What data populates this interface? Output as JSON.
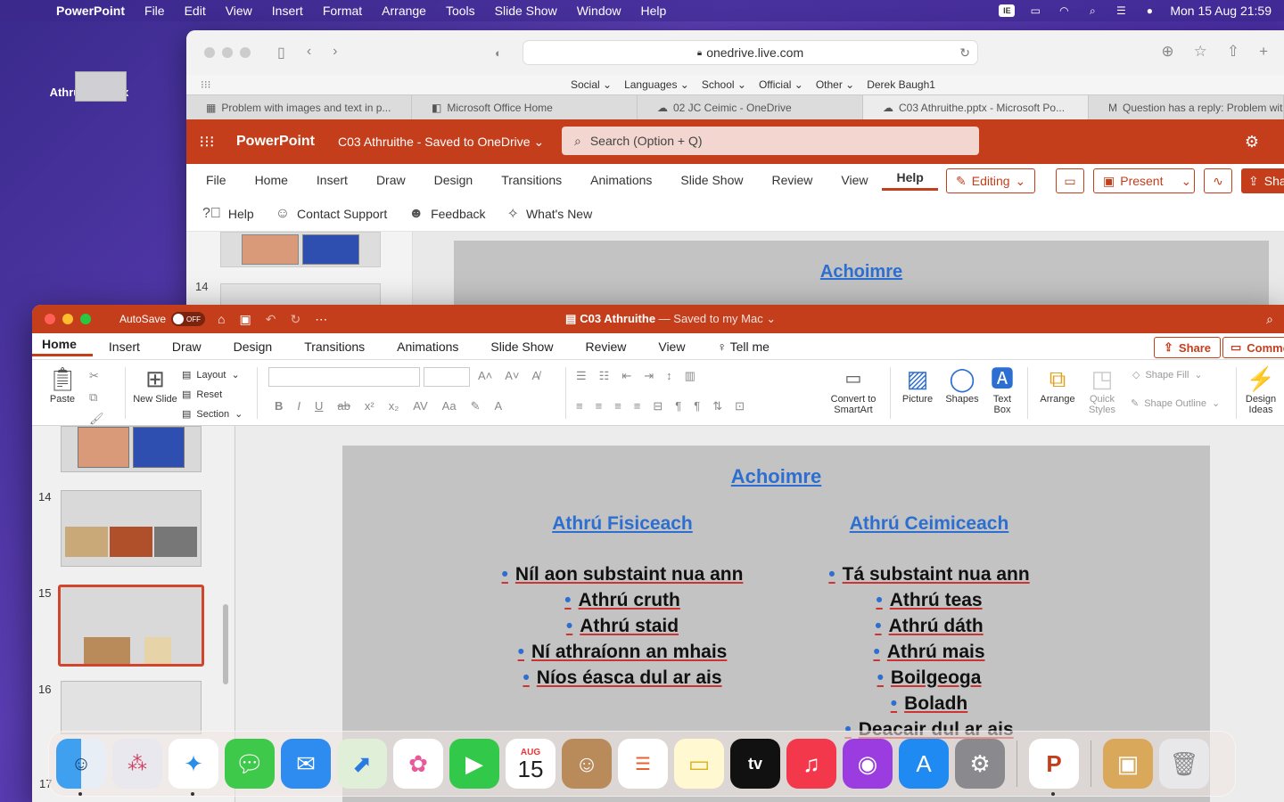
{
  "menubar": {
    "app": "PowerPoint",
    "items": [
      "File",
      "Edit",
      "View",
      "Insert",
      "Format",
      "Arrange",
      "Tools",
      "Slide Show",
      "Window",
      "Help"
    ],
    "datetime": "Mon 15 Aug  21:59"
  },
  "desktop": {
    "file_label": "C03 Athruithe.pptx"
  },
  "safari": {
    "url": "onedrive.live.com",
    "favorites": [
      "Social ⌄",
      "Languages ⌄",
      "School ⌄",
      "Official ⌄",
      "Other ⌄",
      "Derek Baugh1"
    ],
    "tabs": [
      "Problem with images and text in p...",
      "Microsoft Office Home",
      "02 JC Ceimic - OneDrive",
      "C03 Athruithe.pptx - Microsoft Po...",
      "Question has a reply: Problem wit..."
    ],
    "web_app": {
      "brand": "PowerPoint",
      "doc_title": "C03 Athruithe  -  Saved to OneDrive ⌄",
      "search_placeholder": "Search (Option + Q)",
      "menu": [
        "File",
        "Home",
        "Insert",
        "Draw",
        "Design",
        "Transitions",
        "Animations",
        "Slide Show",
        "Review",
        "View",
        "Help"
      ],
      "editing_label": "Editing",
      "present_label": "Present",
      "share_label": "Sha",
      "help_items": [
        "Help",
        "Contact Support",
        "Feedback",
        "What's New"
      ],
      "slide_num": "14",
      "slide_title": "Achoimre"
    }
  },
  "ppt": {
    "autosave_label": "AutoSave",
    "autosave_state": "OFF",
    "title_main": "C03 Athruithe",
    "title_sub": " — Saved to my Mac ⌄",
    "tabs": [
      "Home",
      "Insert",
      "Draw",
      "Design",
      "Transitions",
      "Animations",
      "Slide Show",
      "Review",
      "View"
    ],
    "tell_me": "Tell me",
    "share_label": "Share",
    "comments_label": "Comme",
    "ribbon": {
      "paste": "Paste",
      "new_slide": "New Slide",
      "layout": "Layout",
      "reset": "Reset",
      "section": "Section",
      "convert": "Convert to SmartArt",
      "picture": "Picture",
      "shapes": "Shapes",
      "text_box": "Text Box",
      "arrange": "Arrange",
      "quick_styles": "Quick Styles",
      "shape_fill": "Shape Fill",
      "shape_outline": "Shape Outline",
      "design_ideas": "Design Ideas"
    },
    "thumbs": {
      "n14": "14",
      "n15": "15",
      "n16": "16",
      "n17": "17"
    },
    "slide": {
      "title": "Achoimre",
      "left_heading": "Athrú Fisiceach",
      "left_items": [
        "Níl aon substaint nua ann",
        "Athrú cruth",
        "Athrú staid",
        "Ní athraíonn an mhais",
        "Níos éasca dul ar ais"
      ],
      "right_heading": "Athrú Ceimiceach",
      "right_items": [
        "Tá substaint nua ann",
        "Athrú teas",
        "Athrú dáth",
        "Athrú mais",
        "Boilgeoga",
        "Boladh",
        "Deacair dul ar ais"
      ]
    }
  },
  "dock": {
    "calendar_month": "AUG",
    "calendar_day": "15",
    "tv_label": "tv"
  },
  "colors": {
    "accent": "#c43e1c",
    "slide_blue": "#2d6fd0"
  }
}
